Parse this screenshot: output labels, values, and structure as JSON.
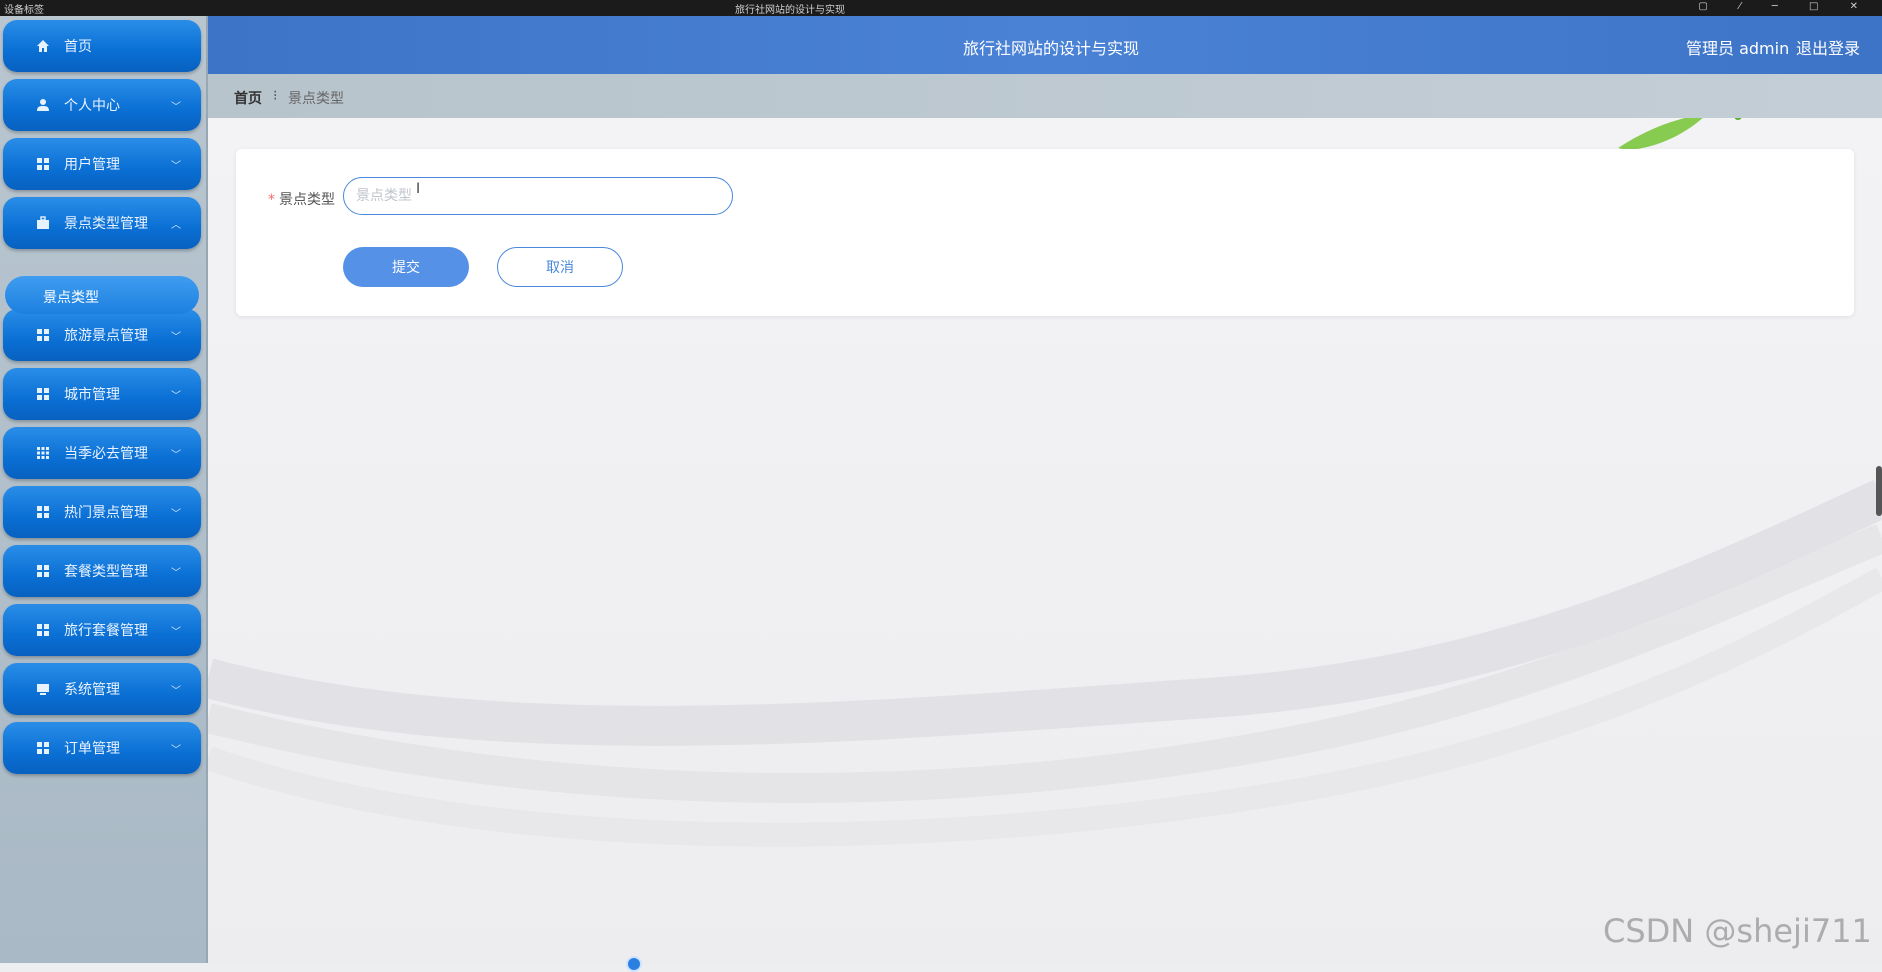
{
  "os_bar": {
    "left_text": "设备标签",
    "title": "旅行社网站的设计与实现"
  },
  "header": {
    "title": "旅行社网站的设计与实现",
    "user_role": "管理员 admin",
    "logout": "退出登录"
  },
  "sidebar": {
    "items": [
      {
        "label": "首页",
        "icon": "home-icon",
        "has_chevron": false
      },
      {
        "label": "个人中心",
        "icon": "user-icon",
        "has_chevron": true
      },
      {
        "label": "用户管理",
        "icon": "grid-icon",
        "has_chevron": true
      },
      {
        "label": "景点类型管理",
        "icon": "briefcase-icon",
        "has_chevron": true,
        "expanded": true
      },
      {
        "label": "旅游景点管理",
        "icon": "grid-icon",
        "has_chevron": true
      },
      {
        "label": "城市管理",
        "icon": "grid-icon",
        "has_chevron": true
      },
      {
        "label": "当季必去管理",
        "icon": "table-icon",
        "has_chevron": true
      },
      {
        "label": "热门景点管理",
        "icon": "grid-icon",
        "has_chevron": true
      },
      {
        "label": "套餐类型管理",
        "icon": "grid-icon",
        "has_chevron": true
      },
      {
        "label": "旅行套餐管理",
        "icon": "grid-icon",
        "has_chevron": true
      },
      {
        "label": "系统管理",
        "icon": "monitor-icon",
        "has_chevron": true
      },
      {
        "label": "订单管理",
        "icon": "grid-icon",
        "has_chevron": true
      }
    ],
    "active_sub_item": "景点类型"
  },
  "breadcrumb": {
    "home": "首页",
    "separator": "⁝",
    "current": "景点类型"
  },
  "form": {
    "field_label": "景点类型",
    "required_mark": "*",
    "input_value": "",
    "input_placeholder": "景点类型",
    "submit_label": "提交",
    "cancel_label": "取消"
  },
  "watermark": "CSDN @sheji711",
  "colors": {
    "header_blue": "#4a82d6",
    "menu_blue": "#0a6fd4",
    "accent": "#5591e6",
    "required_red": "#f56c6c"
  }
}
